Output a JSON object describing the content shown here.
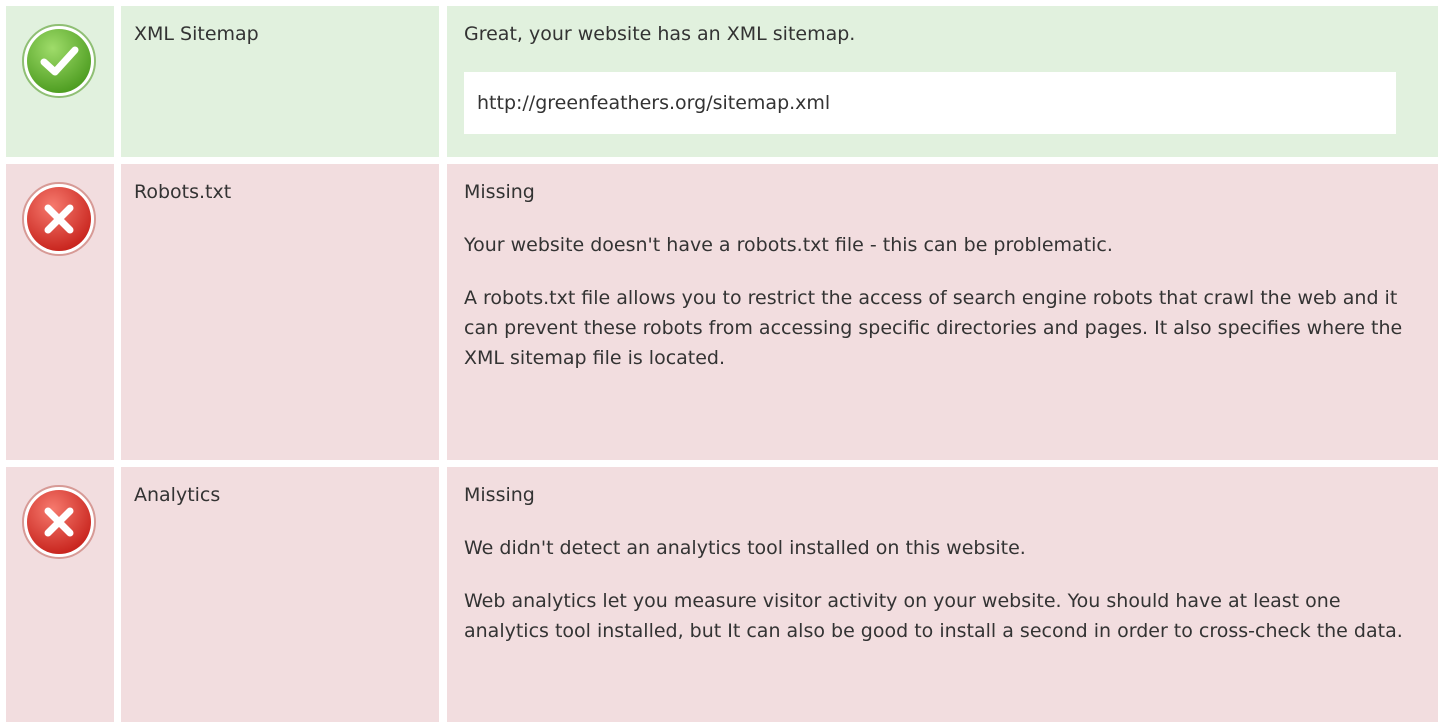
{
  "colors": {
    "pass_bg": "#e1f1de",
    "fail_bg": "#f2dddf",
    "pass_icon": "#6ab83a",
    "fail_icon": "#e0403a",
    "text": "#333333"
  },
  "rows": [
    {
      "status": "pass",
      "icon": "check-icon",
      "name": "XML Sitemap",
      "message": "Great, your website has an XML sitemap.",
      "url": "http://greenfeathers.org/sitemap.xml"
    },
    {
      "status": "fail",
      "icon": "cross-icon",
      "name": "Robots.txt",
      "status_text": "Missing",
      "message": "Your website doesn't have a robots.txt file - this can be problematic.",
      "description": "A robots.txt file allows you to restrict the access of search engine robots that crawl the web and it can prevent these robots from accessing specific directories and pages. It also specifies where the XML sitemap file is located."
    },
    {
      "status": "fail",
      "icon": "cross-icon",
      "name": "Analytics",
      "status_text": "Missing",
      "message": "We didn't detect an analytics tool installed on this website.",
      "description": "Web analytics let you measure visitor activity on your website. You should have at least one analytics tool installed, but It can also be good to install a second in order to cross-check the data."
    }
  ]
}
